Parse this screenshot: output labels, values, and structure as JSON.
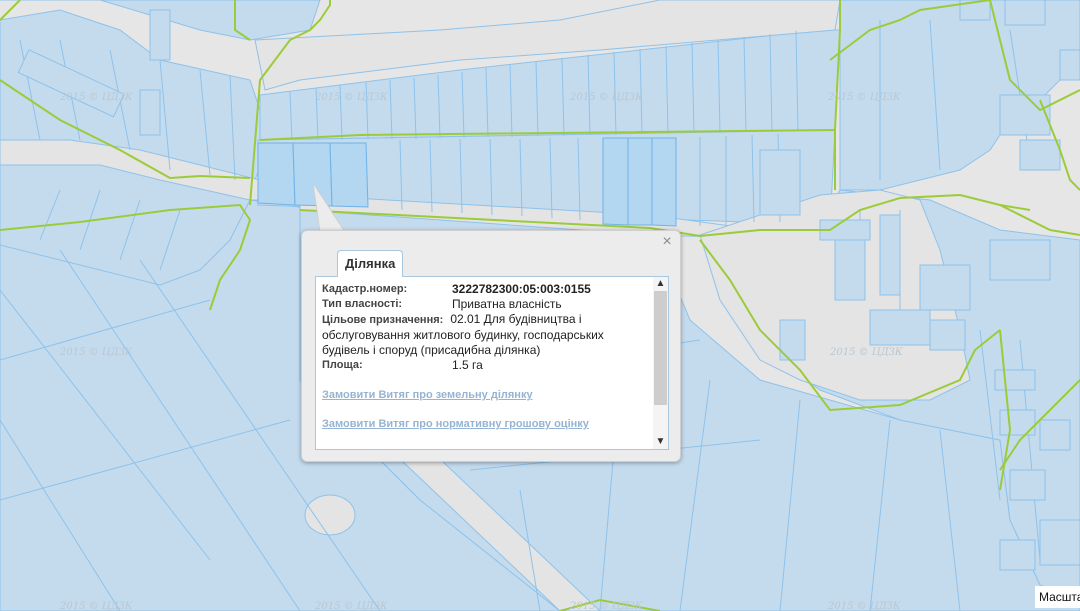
{
  "map": {
    "watermark": "2015 © ЦДЗК",
    "parcel_color": "#c4dbee",
    "parcel_border": "#8ec2ea",
    "selected_color": "#b3d6f1",
    "boundary_color": "#9ccb3a",
    "road_color": "#e4e4e4"
  },
  "popup": {
    "tab_label": "Ділянка",
    "close_icon": "×",
    "fields": {
      "cadastral_label": "Кадастр.номер:",
      "cadastral_value": "3222782300:05:003:0155",
      "ownership_label": "Тип власності:",
      "ownership_value": "Приватна власність",
      "purpose_label": "Цільове призначення:",
      "purpose_value": "02.01 Для будівництва і обслуговування житлового будинку, господарських будівель і споруд (присадибна ділянка)",
      "area_label": "Площа:",
      "area_value": "1.5 га"
    },
    "links": {
      "extract_land": "Замовити Витяг про земельну ділянку",
      "extract_valuation": "Замовити Витяг про нормативну грошову оцінку"
    }
  },
  "scale_label": "Масштаб"
}
